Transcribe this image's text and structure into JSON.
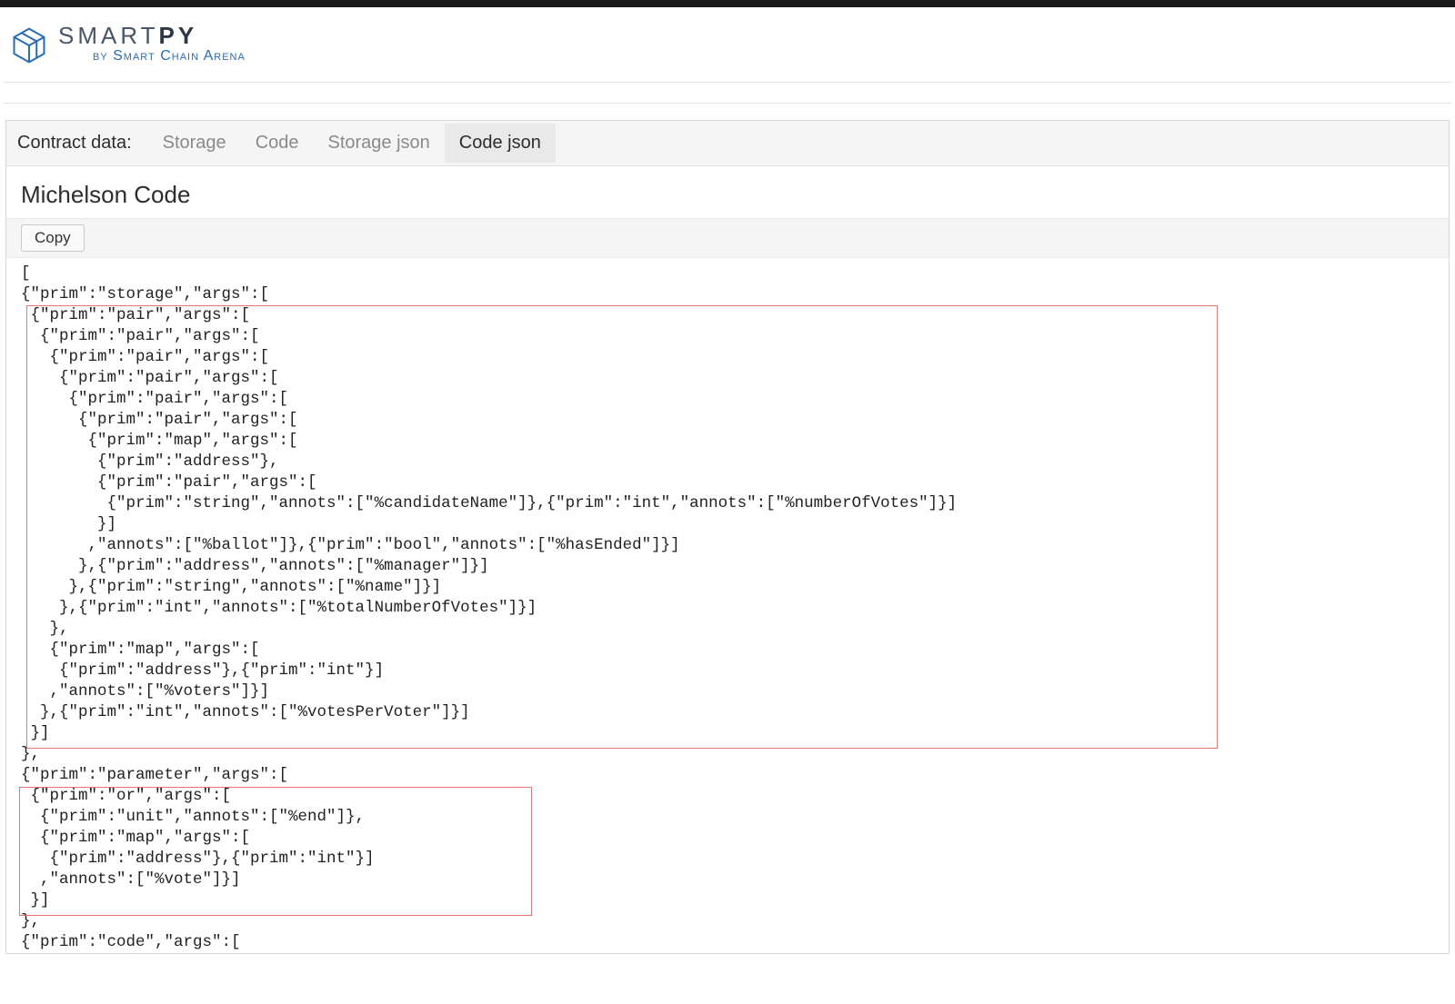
{
  "header": {
    "logo_title_part1": "SMART",
    "logo_title_part2": "PY",
    "logo_sub_prefix": "by ",
    "logo_sub_main": "Smart Chain Arena"
  },
  "tabbar": {
    "label": "Contract data:",
    "tabs": [
      {
        "label": "Storage",
        "active": false
      },
      {
        "label": "Code",
        "active": false
      },
      {
        "label": "Storage json",
        "active": false
      },
      {
        "label": "Code json",
        "active": true
      }
    ]
  },
  "section_title": "Michelson Code",
  "copy_label": "Copy",
  "code": "[\n{\"prim\":\"storage\",\"args\":[\n {\"prim\":\"pair\",\"args\":[\n  {\"prim\":\"pair\",\"args\":[\n   {\"prim\":\"pair\",\"args\":[\n    {\"prim\":\"pair\",\"args\":[\n     {\"prim\":\"pair\",\"args\":[\n      {\"prim\":\"pair\",\"args\":[\n       {\"prim\":\"map\",\"args\":[\n        {\"prim\":\"address\"},\n        {\"prim\":\"pair\",\"args\":[\n         {\"prim\":\"string\",\"annots\":[\"%candidateName\"]},{\"prim\":\"int\",\"annots\":[\"%numberOfVotes\"]}]\n        }]\n       ,\"annots\":[\"%ballot\"]},{\"prim\":\"bool\",\"annots\":[\"%hasEnded\"]}]\n      },{\"prim\":\"address\",\"annots\":[\"%manager\"]}]\n     },{\"prim\":\"string\",\"annots\":[\"%name\"]}]\n    },{\"prim\":\"int\",\"annots\":[\"%totalNumberOfVotes\"]}]\n   },\n   {\"prim\":\"map\",\"args\":[\n    {\"prim\":\"address\"},{\"prim\":\"int\"}]\n   ,\"annots\":[\"%voters\"]}]\n  },{\"prim\":\"int\",\"annots\":[\"%votesPerVoter\"]}]\n }]\n},\n{\"prim\":\"parameter\",\"args\":[\n {\"prim\":\"or\",\"args\":[\n  {\"prim\":\"unit\",\"annots\":[\"%end\"]},\n  {\"prim\":\"map\",\"args\":[\n   {\"prim\":\"address\"},{\"prim\":\"int\"}]\n  ,\"annots\":[\"%vote\"]}]\n }]\n},\n{\"prim\":\"code\",\"args\":["
}
